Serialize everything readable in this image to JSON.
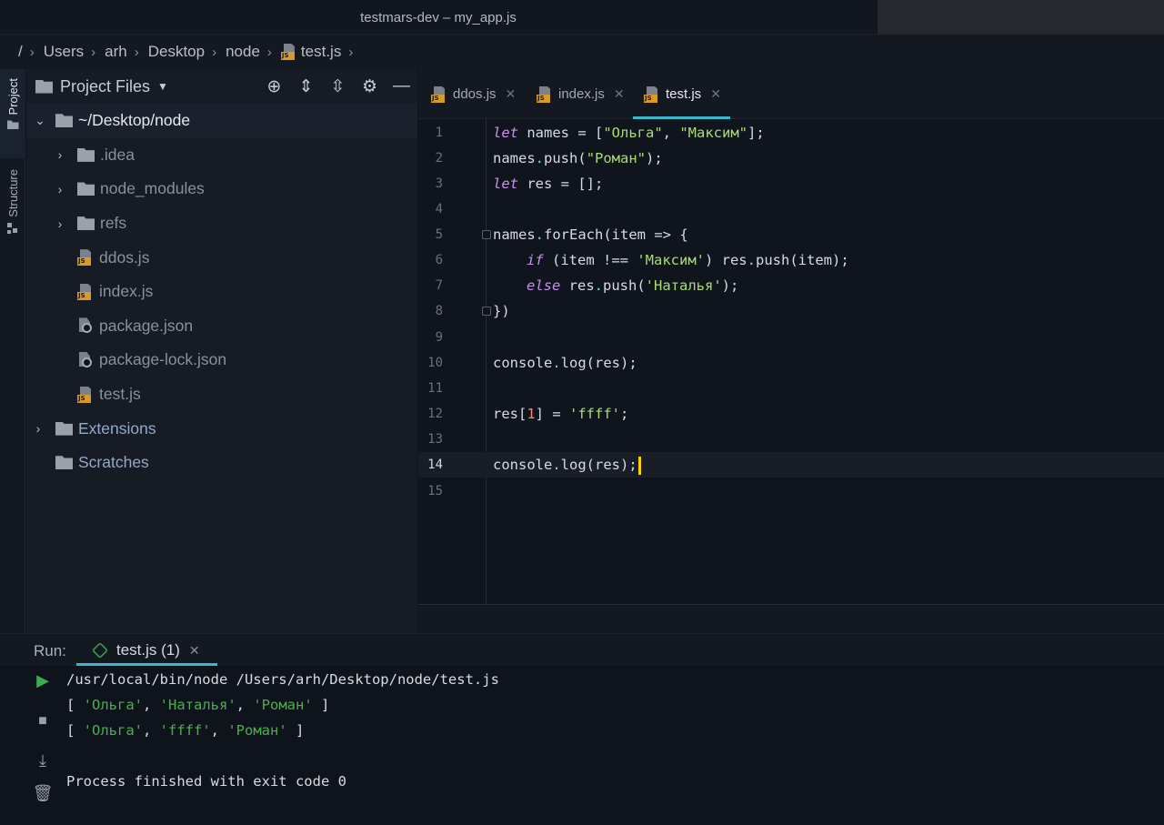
{
  "window": {
    "title": "testmars-dev – my_app.js"
  },
  "breadcrumb": {
    "items": [
      "/",
      "Users",
      "arh",
      "Desktop",
      "node",
      "test.js"
    ]
  },
  "toolstrip": {
    "project_label": "Project",
    "structure_label": "Structure"
  },
  "project_panel": {
    "title": "Project Files",
    "tree": [
      {
        "label": "~/Desktop/node",
        "kind": "folder",
        "expanded": true
      },
      {
        "label": ".idea",
        "kind": "folder"
      },
      {
        "label": "node_modules",
        "kind": "folder"
      },
      {
        "label": "refs",
        "kind": "folder"
      },
      {
        "label": "ddos.js",
        "kind": "js"
      },
      {
        "label": "index.js",
        "kind": "js"
      },
      {
        "label": "package.json",
        "kind": "json"
      },
      {
        "label": "package-lock.json",
        "kind": "json"
      },
      {
        "label": "test.js",
        "kind": "js"
      },
      {
        "label": "Extensions",
        "kind": "folder"
      },
      {
        "label": "Scratches",
        "kind": "folder"
      }
    ]
  },
  "editor": {
    "tabs": [
      {
        "label": "ddos.js",
        "active": false
      },
      {
        "label": "index.js",
        "active": false
      },
      {
        "label": "test.js",
        "active": true
      }
    ],
    "line_numbers": [
      "1",
      "2",
      "3",
      "4",
      "5",
      "6",
      "7",
      "8",
      "9",
      "10",
      "11",
      "12",
      "13",
      "14",
      "15"
    ],
    "current_line": 14,
    "code": {
      "l1": [
        "let",
        " names = [",
        "\"Ольга\"",
        ", ",
        "\"Максим\"",
        "];"
      ],
      "l2": [
        "names",
        ".",
        "push(",
        "\"Роман\"",
        ");"
      ],
      "l3": [
        "let",
        " res = [];"
      ],
      "l5": [
        "names",
        ".",
        "forEach(item => {"
      ],
      "l6": [
        "if",
        " (item !== ",
        "'Максим'",
        ") res",
        ".",
        "push(item);"
      ],
      "l7": [
        "else",
        " res",
        ".",
        "push(",
        "'Наталья'",
        ");"
      ],
      "l8": [
        "})"
      ],
      "l10": [
        "console",
        ".",
        "log(res);"
      ],
      "l12": [
        "res[",
        "1",
        "] = ",
        "'ffff'",
        ";"
      ],
      "l14": [
        "console",
        ".",
        "log(res);"
      ]
    }
  },
  "run_panel": {
    "label": "Run:",
    "tab_label": "test.js (1)",
    "output": {
      "command": "/usr/local/bin/node /Users/arh/Desktop/node/test.js",
      "line1": [
        "[ ",
        "'Ольга'",
        ", ",
        "'Наталья'",
        ", ",
        "'Роман'",
        " ]"
      ],
      "line2": [
        "[ ",
        "'Ольга'",
        ", ",
        "'ffff'",
        ", ",
        "'Роман'",
        " ]"
      ],
      "finished": "Process finished with exit code 0"
    }
  },
  "colors": {
    "accent": "#3ab7c8",
    "caret": "#ffcc00",
    "keyword": "#c593e6",
    "string": "#a9dc76",
    "output_string": "#4caf50"
  },
  "icons": [
    "locate-icon",
    "expand-all-icon",
    "collapse-all-icon",
    "gear-icon",
    "minimize-icon",
    "run-icon",
    "stop-icon",
    "scroll-to-end-icon",
    "trash-icon"
  ]
}
